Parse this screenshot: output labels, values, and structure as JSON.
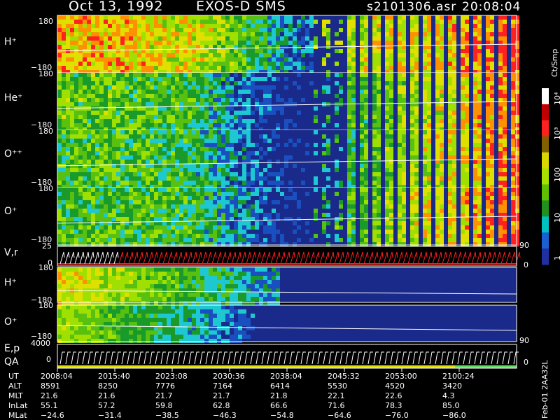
{
  "header": {
    "date": "Oct 13, 1992",
    "instrument": "EXOS-D SMS",
    "file": "s2101306.asr",
    "time": "20:08:04"
  },
  "colorbar": {
    "unit": "Ct/Smp",
    "ticks": [
      "1",
      "10",
      "100",
      "10³",
      "10⁴"
    ],
    "colors": [
      "#ffffff",
      "#c00000",
      "#ff2020",
      "#806000",
      "#d8d800",
      "#a8e000",
      "#60c000",
      "#209020",
      "#00c0c0",
      "#1a60d0",
      "#2030a0"
    ]
  },
  "panels": [
    {
      "name": "H⁺",
      "ymax": "180",
      "ymin": "−180",
      "activity": [
        1,
        1,
        0.9,
        0.85,
        0.7,
        0.6,
        0.5,
        0.6,
        0.65,
        0.75,
        0.85
      ]
    },
    {
      "name": "He⁺",
      "ymax": "180",
      "ymin": "−180",
      "activity": [
        0.55,
        0.55,
        0.5,
        0.4,
        0.25,
        0.2,
        0.25,
        0.4,
        0.55,
        0.65,
        0.8
      ]
    },
    {
      "name": "O⁺⁺",
      "ymax": "180",
      "ymin": "−180",
      "activity": [
        0.5,
        0.5,
        0.45,
        0.35,
        0.25,
        0.2,
        0.25,
        0.4,
        0.55,
        0.65,
        0.8
      ]
    },
    {
      "name": "O⁺",
      "ymax": "180",
      "ymin": "−180",
      "activity": [
        0.5,
        0.5,
        0.45,
        0.4,
        0.3,
        0.25,
        0.3,
        0.45,
        0.6,
        0.7,
        0.85
      ]
    }
  ],
  "vr_panel": {
    "label": "V,r",
    "ymax": "25",
    "ymin": "0",
    "right_max": "90",
    "right_min": "0"
  },
  "lower_panels": [
    {
      "name": "H⁺",
      "ymax": "180",
      "ymin": "−180"
    },
    {
      "name": "O⁺",
      "ymax": "180",
      "ymin": "−180"
    }
  ],
  "ep_panel": {
    "label1": "E,p",
    "label2": "QA",
    "ymax": "4000",
    "ymin": "0",
    "right_max": "90",
    "right_min": "0"
  },
  "footer_code": "Feb-01 2AA32L",
  "chart_data": {
    "type": "heatmap",
    "title": "Oct 13, 1992   EXOS-D SMS",
    "x_ticks": [
      "2008:04",
      "2015:40",
      "2023:08",
      "2030:36",
      "2038:04",
      "2045:32",
      "2053:00",
      "2100:24"
    ],
    "rows": [
      {
        "label": "UT",
        "values": [
          "2008:04",
          "2015:40",
          "2023:08",
          "2030:36",
          "2038:04",
          "2045:32",
          "2053:00",
          "2100:24"
        ]
      },
      {
        "label": "ALT",
        "values": [
          "8591",
          "8250",
          "7776",
          "7164",
          "6414",
          "5530",
          "4520",
          "3420"
        ]
      },
      {
        "label": "MLT",
        "values": [
          "21.6",
          "21.6",
          "21.7",
          "21.7",
          "21.8",
          "22.1",
          "22.6",
          "4.3"
        ]
      },
      {
        "label": "InLat",
        "values": [
          "55.1",
          "57.2",
          "59.8",
          "62.8",
          "66.6",
          "71.6",
          "78.3",
          "85.0"
        ]
      },
      {
        "label": "MLat",
        "values": [
          "−24.6",
          "−31.4",
          "−38.5",
          "−46.3",
          "−54.8",
          "−64.6",
          "−76.0",
          "−86.0"
        ]
      }
    ]
  }
}
